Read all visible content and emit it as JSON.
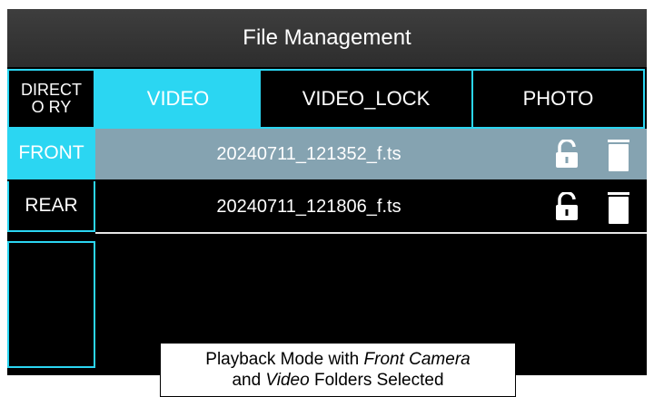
{
  "window": {
    "title": "File Management"
  },
  "tabs": [
    {
      "label": "DIRECTO RY",
      "active": false
    },
    {
      "label": "VIDEO",
      "active": true
    },
    {
      "label": "VIDEO_LOCK",
      "active": false
    },
    {
      "label": "PHOTO",
      "active": false
    }
  ],
  "directory": [
    {
      "label": "FRONT",
      "active": true
    },
    {
      "label": "REAR",
      "active": false
    }
  ],
  "files": [
    {
      "name": "20240711_121352_f.ts",
      "selected": true,
      "lock_icon": "unlock-icon",
      "delete_icon": "trash-icon"
    },
    {
      "name": "20240711_121806_f.ts",
      "selected": false,
      "lock_icon": "unlock-icon",
      "delete_icon": "trash-icon"
    }
  ],
  "caption": {
    "line1_pre": "Playback Mode with ",
    "line1_em": "Front Camera",
    "line2_pre": "and ",
    "line2_em": "Video",
    "line2_post": " Folders Selected"
  },
  "colors": {
    "accent": "#2bd6f2",
    "selected_row": "#85a3b1",
    "titlebar": "#333333",
    "background": "#000000"
  }
}
